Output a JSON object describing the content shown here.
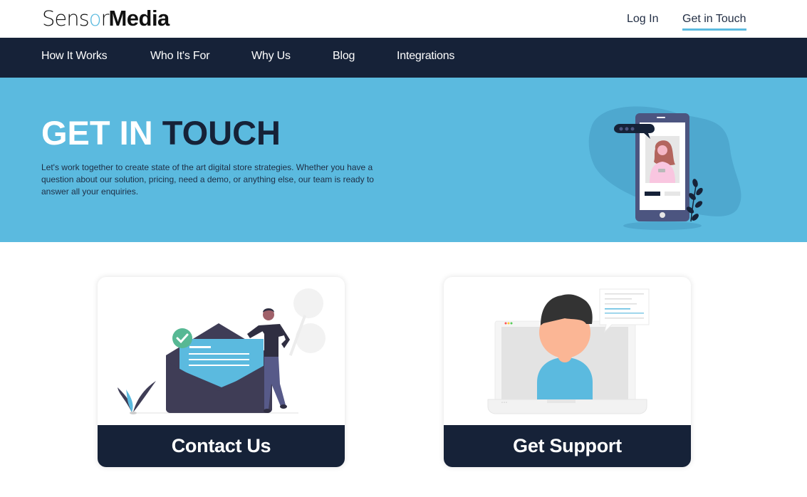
{
  "brand": {
    "logo_prefix_1": "Sens",
    "logo_o": "o",
    "logo_prefix_2": "r",
    "logo_bold": "Media",
    "accent_color": "#5bbadf",
    "dark_color": "#162238"
  },
  "header": {
    "links": [
      {
        "label": "Log In",
        "active": false
      },
      {
        "label": "Get in Touch",
        "active": true
      }
    ]
  },
  "nav": {
    "items": [
      {
        "label": "How It Works"
      },
      {
        "label": "Who It's For"
      },
      {
        "label": "Why Us"
      },
      {
        "label": "Blog"
      },
      {
        "label": "Integrations"
      }
    ]
  },
  "hero": {
    "title_light": "GET IN",
    "title_dark": "TOUCH",
    "description": "Let's work together to create state of the art digital store strategies. Whether you have a question about our solution, pricing, need a demo, or anything else, our team is ready to answer all your enquiries.",
    "illustration": "phone-chat-illustration"
  },
  "cards": [
    {
      "label": "Contact Us",
      "illustration": "envelope-person-illustration"
    },
    {
      "label": "Get Support",
      "illustration": "laptop-support-illustration"
    }
  ]
}
